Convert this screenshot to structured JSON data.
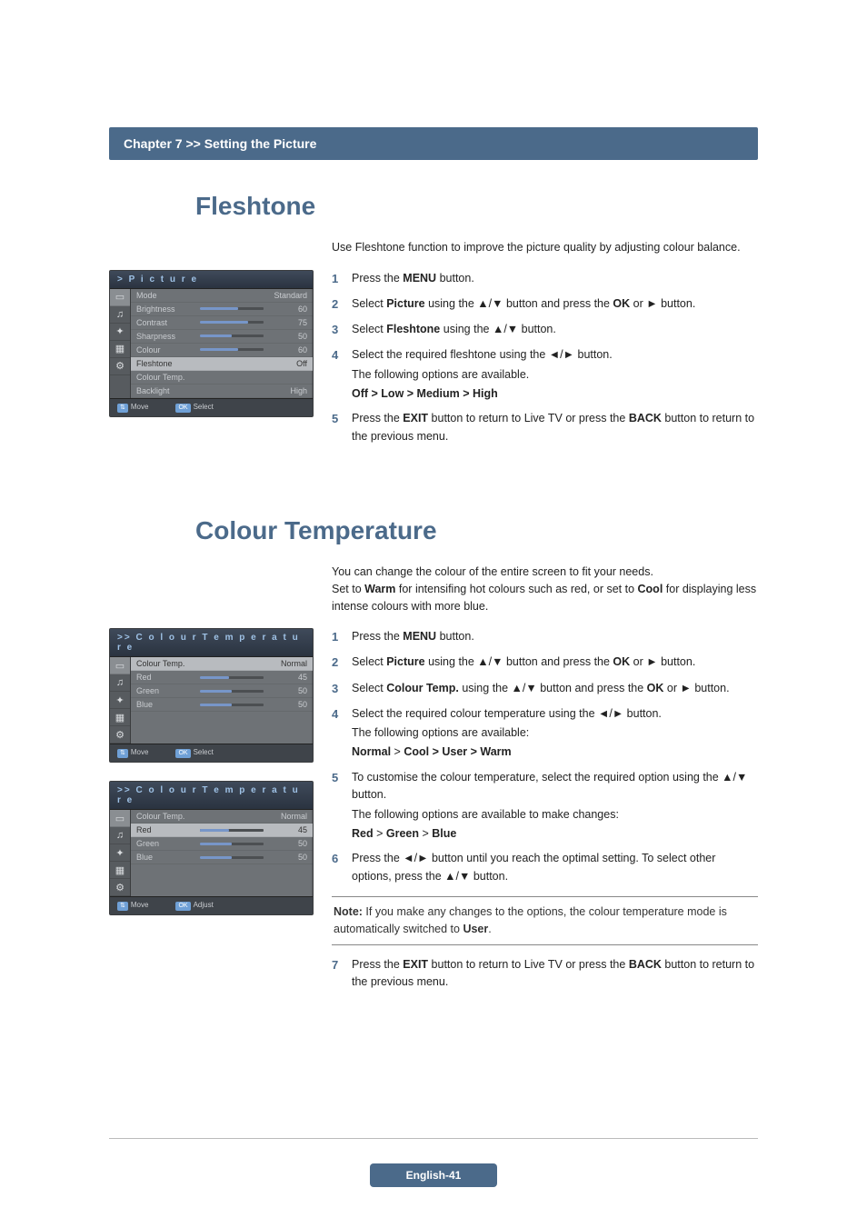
{
  "chapter_bar": "Chapter 7 >> Setting the Picture",
  "section1": {
    "title": "Fleshtone",
    "intro": "Use Fleshtone function to improve the picture quality by adjusting colour balance.",
    "steps": [
      {
        "html": "Press the <b>MENU</b> button."
      },
      {
        "html": "Select <b>Picture</b> using the ▲/▼ button and press the <b>OK</b> or ► button."
      },
      {
        "html": "Select <b>Fleshtone</b> using the ▲/▼ button."
      },
      {
        "html": "Select the required fleshtone using the ◄/► button.<span class='sub-indent'>The following options are available.</span><span class='sub-indent'><b>Off &gt; Low &gt; Medium &gt; High</b></span>"
      },
      {
        "html": "Press the <b>EXIT</b> button to return to Live TV or press the <b>BACK</b> button to return to the previous menu."
      }
    ],
    "menu": {
      "header": ">  P i c t u r e",
      "rows": [
        {
          "label": "Mode",
          "value": "Standard",
          "bar": null
        },
        {
          "label": "Brightness",
          "value": "60",
          "bar": 60
        },
        {
          "label": "Contrast",
          "value": "75",
          "bar": 75
        },
        {
          "label": "Sharpness",
          "value": "50",
          "bar": 50
        },
        {
          "label": "Colour",
          "value": "60",
          "bar": 60
        },
        {
          "label": "Fleshtone",
          "value": "Off",
          "bar": null,
          "sel": true
        },
        {
          "label": "Colour Temp.",
          "value": "",
          "bar": null
        },
        {
          "label": "Backlight",
          "value": "High",
          "bar": null
        }
      ],
      "footer_left": "Move",
      "footer_right": "Select"
    }
  },
  "section2": {
    "title": "Colour Temperature",
    "intro": "You can change the colour of the entire screen to fit your needs.\nSet to <b>Warm</b> for intensifing hot colours such as red, or set to <b>Cool</b> for displaying less intense colours with more blue.",
    "steps": [
      {
        "html": "Press the <b>MENU</b> button."
      },
      {
        "html": "Select <b>Picture</b> using the ▲/▼ button and press the <b>OK</b> or ► button."
      },
      {
        "html": "Select <b>Colour Temp.</b> using the ▲/▼ button and press the <b>OK</b> or ► button."
      },
      {
        "html": "Select the required colour temperature using the ◄/► button.<span class='sub-indent'>The following options are available:</span><span class='sub-indent'><b>Normal</b> &gt; <b>Cool &gt; User &gt; Warm</b></span>"
      },
      {
        "html": "To customise the colour temperature, select the required option using the ▲/▼ button.<span class='sub-indent'>The following options are available to make changes:</span><span class='sub-indent'><b>Red</b> &gt; <b>Green</b> &gt; <b>Blue</b></span>"
      },
      {
        "html": "Press the ◄/► button until you reach the optimal setting. To select other options, press the ▲/▼ button."
      }
    ],
    "note": "<b>Note:</b> If you make any changes to the options, the colour temperature mode is automatically switched to <b>User</b>.",
    "step7": {
      "html": "Press the <b>EXIT</b> button to return to Live TV or press the <b>BACK</b> button to return to the previous menu."
    },
    "menuA": {
      "header": ">>  C o l o u r  T e m p e r a t u r e",
      "rows": [
        {
          "label": "Colour Temp.",
          "value": "Normal",
          "bar": null,
          "sel": true
        },
        {
          "label": "Red",
          "value": "45",
          "bar": 45
        },
        {
          "label": "Green",
          "value": "50",
          "bar": 50
        },
        {
          "label": "Blue",
          "value": "50",
          "bar": 50
        }
      ],
      "footer_left": "Move",
      "footer_right": "Select"
    },
    "menuB": {
      "header": ">>  C o l o u r  T e m p e r a t u r e",
      "rows": [
        {
          "label": "Colour Temp.",
          "value": "Normal",
          "bar": null
        },
        {
          "label": "Red",
          "value": "45",
          "bar": 45,
          "sel": true
        },
        {
          "label": "Green",
          "value": "50",
          "bar": 50
        },
        {
          "label": "Blue",
          "value": "50",
          "bar": 50
        }
      ],
      "footer_left": "Move",
      "footer_right": "Adjust"
    }
  },
  "footer": "English-41"
}
